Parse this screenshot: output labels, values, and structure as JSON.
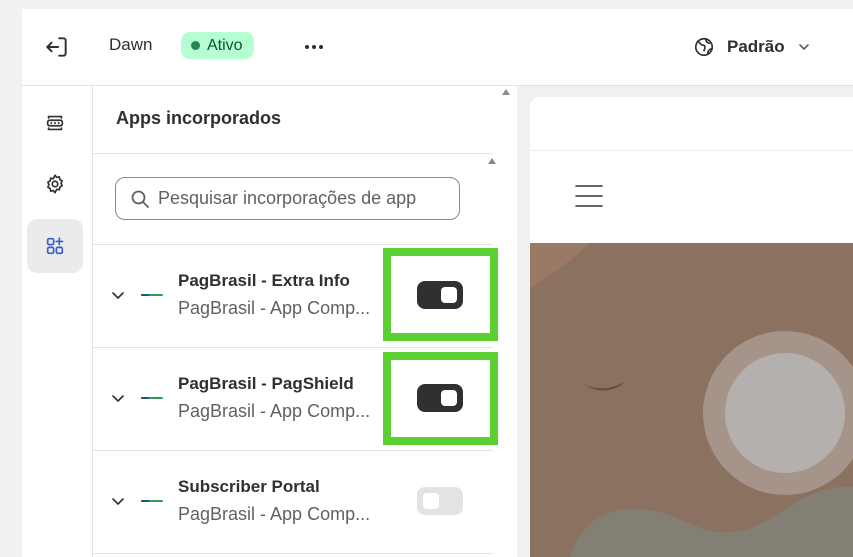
{
  "topbar": {
    "theme_name": "Dawn",
    "status_badge": "Ativo",
    "locale_label": "Padrão"
  },
  "rail": {
    "items": [
      {
        "icon": "sections-icon",
        "active": false
      },
      {
        "icon": "gear-icon",
        "active": false
      },
      {
        "icon": "app-embed-icon",
        "active": true
      }
    ]
  },
  "panel": {
    "title": "Apps incorporados",
    "search": {
      "placeholder": "Pesquisar incorporações de app",
      "value": ""
    },
    "apps": [
      {
        "name": "PagBrasil - Extra Info",
        "subtitle": "PagBrasil - App Comp...",
        "enabled": true,
        "highlighted": true
      },
      {
        "name": "PagBrasil - PagShield",
        "subtitle": "PagBrasil - App Comp...",
        "enabled": true,
        "highlighted": true
      },
      {
        "name": "Subscriber Portal",
        "subtitle": "PagBrasil - App Comp...",
        "enabled": false,
        "highlighted": false
      }
    ]
  },
  "colors": {
    "badge_bg": "#b4fed2",
    "badge_text": "#0c5132",
    "toggle_on": "#303030",
    "toggle_off": "#e3e3e3",
    "highlight": "#5cd030",
    "hero_bg": "#8b7160"
  }
}
